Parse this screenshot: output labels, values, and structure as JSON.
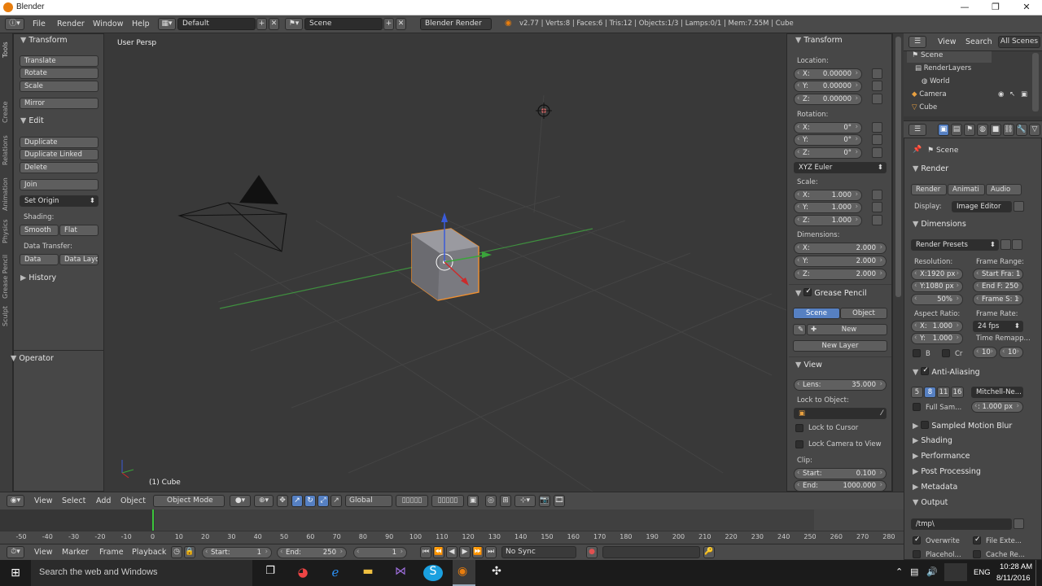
{
  "window": {
    "title": "Blender",
    "min": "—",
    "max": "❐",
    "close": "✕"
  },
  "header": {
    "menus": [
      "File",
      "Render",
      "Window",
      "Help"
    ],
    "layout": "Default",
    "scene": "Scene",
    "engine": "Blender Render",
    "info": "v2.77 | Verts:8 | Faces:6 | Tris:12 | Objects:1/3 | Lamps:0/1 | Mem:7.55M | Cube"
  },
  "tabs_left": [
    "Tools",
    "Create",
    "Relations",
    "Animation",
    "Physics",
    "Grease Pencil",
    "Sculpt"
  ],
  "toolshelf": {
    "transform_title": "Transform",
    "translate": "Translate",
    "rotate": "Rotate",
    "scale": "Scale",
    "mirror": "Mirror",
    "edit_title": "Edit",
    "duplicate": "Duplicate",
    "duplicate_linked": "Duplicate Linked",
    "delete": "Delete",
    "join": "Join",
    "set_origin": "Set Origin",
    "shading_label": "Shading:",
    "smooth": "Smooth",
    "flat": "Flat",
    "data_transfer_label": "Data Transfer:",
    "data": "Data",
    "data_layo": "Data Layo",
    "history_title": "History",
    "operator_title": "Operator"
  },
  "viewport": {
    "persp": "User Persp",
    "object_label": "(1) Cube"
  },
  "properties_n": {
    "transform_title": "Transform",
    "location_label": "Location:",
    "loc": [
      {
        "l": "X:",
        "v": "0.00000"
      },
      {
        "l": "Y:",
        "v": "0.00000"
      },
      {
        "l": "Z:",
        "v": "0.00000"
      }
    ],
    "rotation_label": "Rotation:",
    "rot": [
      {
        "l": "X:",
        "v": "0°"
      },
      {
        "l": "Y:",
        "v": "0°"
      },
      {
        "l": "Z:",
        "v": "0°"
      }
    ],
    "rotation_mode": "XYZ Euler",
    "scale_label": "Scale:",
    "scl": [
      {
        "l": "X:",
        "v": "1.000"
      },
      {
        "l": "Y:",
        "v": "1.000"
      },
      {
        "l": "Z:",
        "v": "1.000"
      }
    ],
    "dimensions_label": "Dimensions:",
    "dim": [
      {
        "l": "X:",
        "v": "2.000"
      },
      {
        "l": "Y:",
        "v": "2.000"
      },
      {
        "l": "Z:",
        "v": "2.000"
      }
    ],
    "grease_title": "Grease Pencil",
    "gp_scene": "Scene",
    "gp_object": "Object",
    "gp_new": "New",
    "gp_new_layer": "New Layer",
    "view_title": "View",
    "lens_label": "Lens:",
    "lens_value": "35.000",
    "lock_object_label": "Lock to Object:",
    "lock_cursor": "Lock to Cursor",
    "lock_camera": "Lock Camera to View",
    "clip_label": "Clip:",
    "clip_start_l": "Start:",
    "clip_start_v": "0.100",
    "clip_end_l": "End:",
    "clip_end_v": "1000.000"
  },
  "outliner": {
    "view": "View",
    "search": "Search",
    "all_scenes": "All Scenes",
    "items": [
      "Scene",
      "RenderLayers",
      "World",
      "Camera",
      "Cube"
    ]
  },
  "render_props": {
    "scene_label": "Scene",
    "render_title": "Render",
    "render_btn": "Render",
    "anim_btn": "Animati",
    "audio_btn": "Audio",
    "display_label": "Display:",
    "display_value": "Image Editor",
    "dimensions_title": "Dimensions",
    "presets": "Render Presets",
    "resolution_label": "Resolution:",
    "frame_range_label": "Frame Range:",
    "res_x": "X:1920 px",
    "res_y": "Y:1080 px",
    "res_pct": "50%",
    "start_fr": "Start Fra: 1",
    "end_fr": "End F: 250",
    "frame_step": "Frame S: 1",
    "aspect_label": "Aspect Ratio:",
    "frame_rate_label": "Frame Rate:",
    "asp_x_l": "X:",
    "asp_x_v": "1.000",
    "asp_y_l": "Y:",
    "asp_y_v": "1.000",
    "fps": "24 fps",
    "time_remap": "Time Remapp...",
    "b_label": "B",
    "cr_label": "Cr",
    "remap_old": "10",
    "remap_new": "10",
    "aa_title": "Anti-Aliasing",
    "aa_samples": [
      "5",
      "8",
      "11",
      "16"
    ],
    "aa_filter": "Mitchell-Ne...",
    "full_sample": "Full Sam...",
    "aa_size": ": 1.000 px",
    "smb_title": "Sampled Motion Blur",
    "shading_title": "Shading",
    "performance_title": "Performance",
    "post_title": "Post Processing",
    "metadata_title": "Metadata",
    "output_title": "Output",
    "output_path": "/tmp\\",
    "overwrite": "Overwrite",
    "file_ext": "File Exte...",
    "placeholders": "Placehol...",
    "cache": "Cache Re..."
  },
  "view3d_header": {
    "view": "View",
    "select": "Select",
    "add": "Add",
    "object": "Object",
    "mode": "Object Mode",
    "orientation": "Global"
  },
  "timeline": {
    "ticks": [
      "-50",
      "-40",
      "-30",
      "-20",
      "-10",
      "0",
      "10",
      "20",
      "30",
      "40",
      "50",
      "60",
      "70",
      "80",
      "90",
      "100",
      "110",
      "120",
      "130",
      "140",
      "150",
      "160",
      "170",
      "180",
      "190",
      "200",
      "210",
      "220",
      "230",
      "240",
      "250",
      "260",
      "270",
      "280"
    ],
    "current_frame": 0
  },
  "timeline_header": {
    "view": "View",
    "marker": "Marker",
    "frame": "Frame",
    "playback": "Playback",
    "start_l": "Start:",
    "start_v": "1",
    "end_l": "End:",
    "end_v": "250",
    "current": "1",
    "sync": "No Sync"
  },
  "taskbar": {
    "search": "Search the web and Windows",
    "lang": "ENG",
    "time": "10:28 AM",
    "date": "8/11/2016"
  },
  "colors": {
    "accent": "#5680c2",
    "bg": "#393939",
    "panel": "#474747",
    "orange": "#e87d0d"
  }
}
